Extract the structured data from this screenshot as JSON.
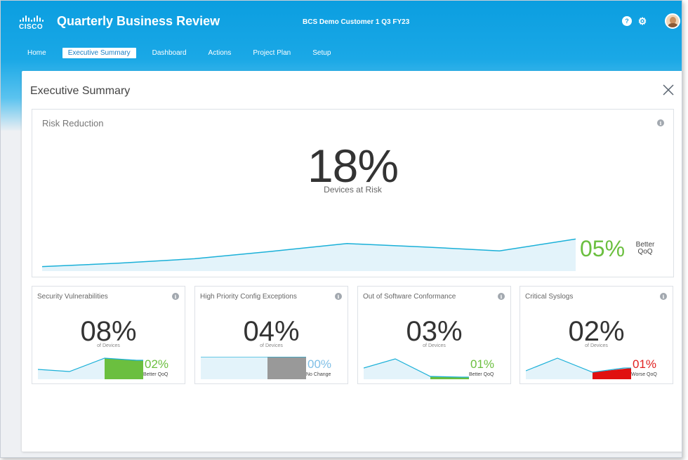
{
  "header": {
    "logo_text": "CISCO",
    "title": "Quarterly Business Review",
    "customer": "BCS Demo Customer 1 Q3 FY23",
    "help_glyph": "?",
    "gear_glyph": "⚙",
    "icons": [
      "help-icon",
      "gear-icon",
      "avatar"
    ]
  },
  "nav": {
    "items": [
      {
        "label": "Home",
        "active": false
      },
      {
        "label": "Executive Summary",
        "active": true
      },
      {
        "label": "Dashboard",
        "active": false
      },
      {
        "label": "Actions",
        "active": false
      },
      {
        "label": "Project Plan",
        "active": false
      },
      {
        "label": "Setup",
        "active": false
      }
    ]
  },
  "panel": {
    "title": "Executive Summary",
    "close_icon": "close-icon"
  },
  "risk": {
    "title": "Risk Reduction",
    "value": "18%",
    "subtitle": "Devices at Risk",
    "change": "05%",
    "change_label_1": "Better",
    "change_label_2": "QoQ",
    "trend": [
      8,
      14,
      22,
      35,
      49,
      43,
      36,
      57
    ],
    "trend_max": 100,
    "color_line": "#1ab0d8",
    "color_fill": "#e3f3fa",
    "color_positive": "#6bbf3f"
  },
  "cards": [
    {
      "title": "Security Vulnerabilities",
      "value": "08%",
      "unit": "of Devices",
      "delta": "02%",
      "delta_label": "Better QoQ",
      "delta_color": "#6bbf3f",
      "trend": [
        14,
        11,
        30,
        27
      ],
      "change_color": "#6bbf3f",
      "change_kind": "decrease"
    },
    {
      "title": "High Priority Config Exceptions",
      "value": "04%",
      "unit": "of Devices",
      "delta": "00%",
      "delta_label": "No Change",
      "delta_color": "#7fbfe6",
      "trend": [
        32,
        32,
        32,
        32
      ],
      "change_color": "#999999",
      "change_kind": "flat"
    },
    {
      "title": "Out of Software Conformance",
      "value": "03%",
      "unit": "of Devices",
      "delta": "01%",
      "delta_label": "Better QoQ",
      "delta_color": "#6bbf3f",
      "trend": [
        16,
        29,
        4,
        3
      ],
      "change_color": "#6bbf3f",
      "change_kind": "decrease"
    },
    {
      "title": "Critical Syslogs",
      "value": "02%",
      "unit": "of Devices",
      "delta": "01%",
      "delta_label": "Worse QoQ",
      "delta_color": "#e02020",
      "trend": [
        12,
        30,
        10,
        16
      ],
      "change_color": "#e01010",
      "change_kind": "increase"
    }
  ]
}
